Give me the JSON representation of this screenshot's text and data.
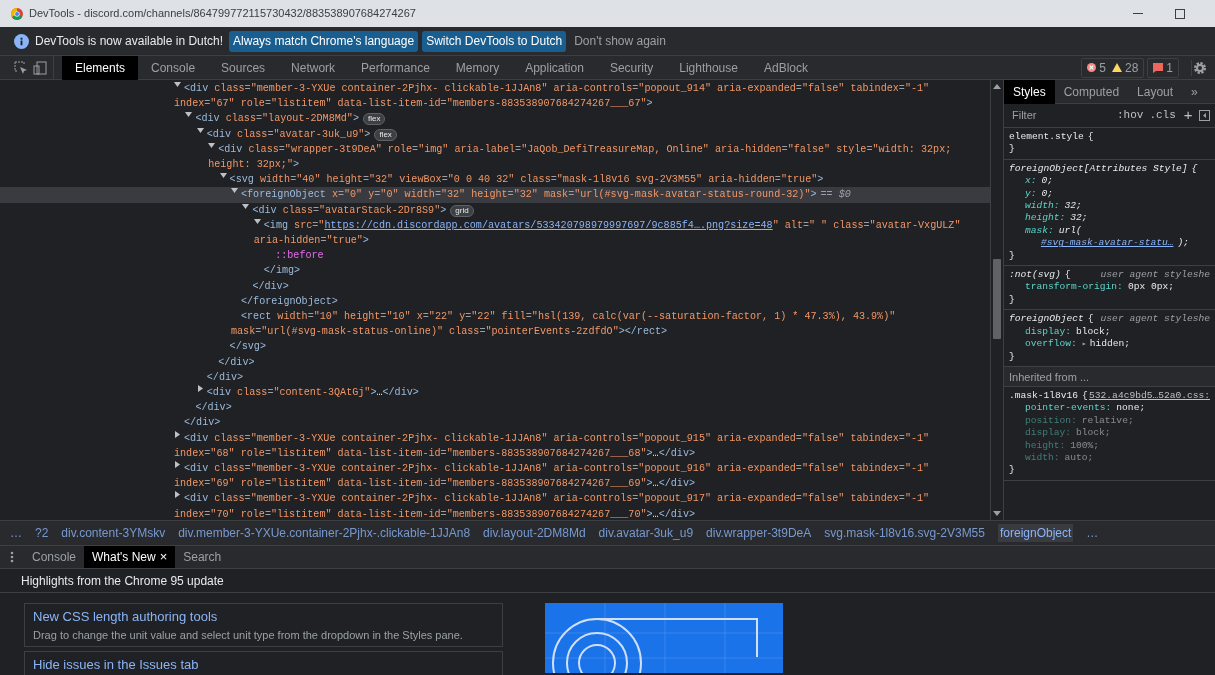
{
  "window": {
    "title": "DevTools - discord.com/channels/864799772115730432/883538907684274267"
  },
  "infobar": {
    "message": "DevTools is now available in Dutch!",
    "buttons": [
      {
        "label": "Always match Chrome's language",
        "kind": "primary"
      },
      {
        "label": "Switch DevTools to Dutch",
        "kind": "primary"
      },
      {
        "label": "Don't show again",
        "kind": "plain"
      }
    ]
  },
  "main_tabs": [
    {
      "label": "Elements",
      "selected": true
    },
    {
      "label": "Console",
      "selected": false
    },
    {
      "label": "Sources",
      "selected": false
    },
    {
      "label": "Network",
      "selected": false
    },
    {
      "label": "Performance",
      "selected": false
    },
    {
      "label": "Memory",
      "selected": false
    },
    {
      "label": "Application",
      "selected": false
    },
    {
      "label": "Security",
      "selected": false
    },
    {
      "label": "Lighthouse",
      "selected": false
    },
    {
      "label": "AdBlock",
      "selected": false
    }
  ],
  "counters": {
    "errors": "5",
    "warnings": "28",
    "issues": "1"
  },
  "dom_tree": [
    {
      "line": "<div class=\"member-3-YXUe container-2Pjhx- clickable-1JJAn8\" aria-controls=\"popout_914\" aria-expanded=\"false\" tabindex=\"-1\" index=\"67\" role=\"listitem\" data-list-item-id=\"members-883538907684274267___67\">",
      "expanded": true,
      "selected": false,
      "close": "</div>",
      "children": [
        {
          "line": "<div class=\"layout-2DM8Md\">",
          "badge": "flex",
          "expanded": true,
          "selected": false,
          "close": "</div>",
          "children": [
            {
              "line": "<div class=\"avatar-3uk_u9\">",
              "badge": "flex",
              "expanded": true,
              "selected": false,
              "close": "</div>",
              "children": [
                {
                  "line": "<div class=\"wrapper-3t9DeA\" role=\"img\" aria-label=\"JaQob_DefiTreasureMap, Online\" aria-hidden=\"false\" style=\"width: 32px; height: 32px;\">",
                  "expanded": true,
                  "selected": false,
                  "close": "</div>",
                  "children": [
                    {
                      "line": "<svg width=\"40\" height=\"32\" viewBox=\"0 0 40 32\" class=\"mask-1l8v16 svg-2V3M55\" aria-hidden=\"true\">",
                      "expanded": true,
                      "selected": false,
                      "close": "</svg>",
                      "children": [
                        {
                          "line": "<foreignObject x=\"0\" y=\"0\" width=\"32\" height=\"32\" mask=\"url(#svg-mask-avatar-status-round-32)\">",
                          "suffix": "== $0",
                          "expanded": true,
                          "selected": true,
                          "close": "</foreignObject>",
                          "children": [
                            {
                              "line": "<div class=\"avatarStack-2Dr8S9\">",
                              "badge": "grid",
                              "expanded": true,
                              "selected": false,
                              "close": "</div>",
                              "children": [
                                {
                                  "line": "<img src=\"https://cdn.discordapp.com/avatars/533420798979997697/9c885f4….png?size=48\" alt=\" \" class=\"avatar-VxgULZ\" aria-hidden=\"true\">",
                                  "expanded": true,
                                  "selected": false,
                                  "close": "</img>",
                                  "children": [
                                    {
                                      "line": "::before",
                                      "selected": false
                                    }
                                  ]
                                }
                              ]
                            }
                          ]
                        },
                        {
                          "line": "<rect width=\"10\" height=\"10\" x=\"22\" y=\"22\" fill=\"hsl(139, calc(var(--saturation-factor, 1) * 47.3%), 43.9%)\" mask=\"url(#svg-mask-status-online)\" class=\"pointerEvents-2zdfdO\"></rect>",
                          "selected": false
                        }
                      ]
                    }
                  ]
                }
              ]
            },
            {
              "line": "<div class=\"content-3QAtGj\">",
              "inner": "…",
              "expanded": false,
              "selected": false,
              "close": "</div>"
            }
          ]
        }
      ]
    },
    {
      "line": "<div class=\"member-3-YXUe container-2Pjhx- clickable-1JJAn8\" aria-controls=\"popout_915\" aria-expanded=\"false\" tabindex=\"-1\" index=\"68\" role=\"listitem\" data-list-item-id=\"members-883538907684274267___68\">",
      "inner": "…",
      "expanded": false,
      "selected": false,
      "close": "</div>"
    },
    {
      "line": "<div class=\"member-3-YXUe container-2Pjhx- clickable-1JJAn8\" aria-controls=\"popout_916\" aria-expanded=\"false\" tabindex=\"-1\" index=\"69\" role=\"listitem\" data-list-item-id=\"members-883538907684274267___69\">",
      "inner": "…",
      "expanded": false,
      "selected": false,
      "close": "</div>"
    },
    {
      "line": "<div class=\"member-3-YXUe container-2Pjhx- clickable-1JJAn8\" aria-controls=\"popout_917\" aria-expanded=\"false\" tabindex=\"-1\" index=\"70\" role=\"listitem\" data-list-item-id=\"members-883538907684274267___70\">",
      "inner": "…",
      "expanded": false,
      "selected": false,
      "close": "</div>"
    }
  ],
  "breadcrumbs": [
    {
      "label": "…",
      "selected": false
    },
    {
      "label": "?2",
      "selected": false
    },
    {
      "label": "div.content-3YMskv",
      "selected": false
    },
    {
      "label": "div.member-3-YXUe.container-2Pjhx-.clickable-1JJAn8",
      "selected": false
    },
    {
      "label": "div.layout-2DM8Md",
      "selected": false
    },
    {
      "label": "div.avatar-3uk_u9",
      "selected": false
    },
    {
      "label": "div.wrapper-3t9DeA",
      "selected": false
    },
    {
      "label": "svg.mask-1l8v16.svg-2V3M55",
      "selected": false
    },
    {
      "label": "foreignObject",
      "selected": true
    },
    {
      "label": "…",
      "selected": false
    }
  ],
  "styles_tabs": [
    {
      "label": "Styles",
      "selected": true
    },
    {
      "label": "Computed",
      "selected": false
    },
    {
      "label": "Layout",
      "selected": false
    },
    {
      "label": "»",
      "selected": false
    }
  ],
  "styles_filter": {
    "placeholder": "Filter",
    "hov": ":hov",
    "cls": ".cls",
    "add": "+"
  },
  "style_sections": [
    {
      "kind": "inline-rule",
      "selector": "element.style",
      "open": "{",
      "close": "}"
    },
    {
      "kind": "attribute-rule",
      "selector": "foreignObject[Attributes Style]",
      "open": "{",
      "close": "}",
      "declarations": [
        {
          "prop": "x:",
          "value": "0;",
          "inactive": false
        },
        {
          "prop": "y:",
          "value": "0;",
          "inactive": false
        },
        {
          "prop": "width:",
          "value": "32;",
          "inactive": false
        },
        {
          "prop": "height:",
          "value": "32;",
          "inactive": false
        },
        {
          "prop": "mask:",
          "value": "url(",
          "link": "#svg-mask-avatar-statu…",
          "tail": ");",
          "inactive": false
        }
      ]
    },
    {
      "kind": "agent-rule",
      "selector": ":not(svg)",
      "open": "{",
      "source": "user agent styleshe",
      "close": "}",
      "declarations": [
        {
          "prop": "transform-origin:",
          "value": "0px 0px;",
          "inactive": false
        }
      ]
    },
    {
      "kind": "agent-rule",
      "selector": "foreignObject",
      "source": "user agent styleshe",
      "open": "{",
      "close": "}",
      "declarations": [
        {
          "prop": "display:",
          "value": "block;",
          "inactive": false
        },
        {
          "prop": "overflow:",
          "value": "hidden;",
          "expander": "▸",
          "inactive": false
        }
      ]
    },
    {
      "kind": "header",
      "label": "Inherited from ..."
    },
    {
      "kind": "author-rule",
      "selector": ".mask-1l8v16",
      "source": "532.a4c9bd5…52a0.css:",
      "open": "{",
      "close": "}",
      "declarations": [
        {
          "prop": "pointer-events:",
          "value": "none;",
          "inactive": false
        },
        {
          "prop": "position:",
          "value": "relative;",
          "inactive": true
        },
        {
          "prop": "display:",
          "value": "block;",
          "inactive": true
        },
        {
          "prop": "height:",
          "value": "100%;",
          "inactive": true
        },
        {
          "prop": "width:",
          "value": "auto;",
          "inactive": true
        }
      ]
    }
  ],
  "drawer": {
    "tabs": [
      {
        "label": "Console",
        "selected": false
      },
      {
        "label": "What's New",
        "selected": true,
        "close": "×"
      },
      {
        "label": "Search",
        "selected": false
      }
    ],
    "heading": "Highlights from the Chrome 95 update",
    "items": [
      {
        "title": "New CSS length authoring tools",
        "description": "Drag to change the unit value and select unit type from the dropdown in the Styles pane."
      },
      {
        "title": "Hide issues in the Issues tab"
      }
    ]
  }
}
